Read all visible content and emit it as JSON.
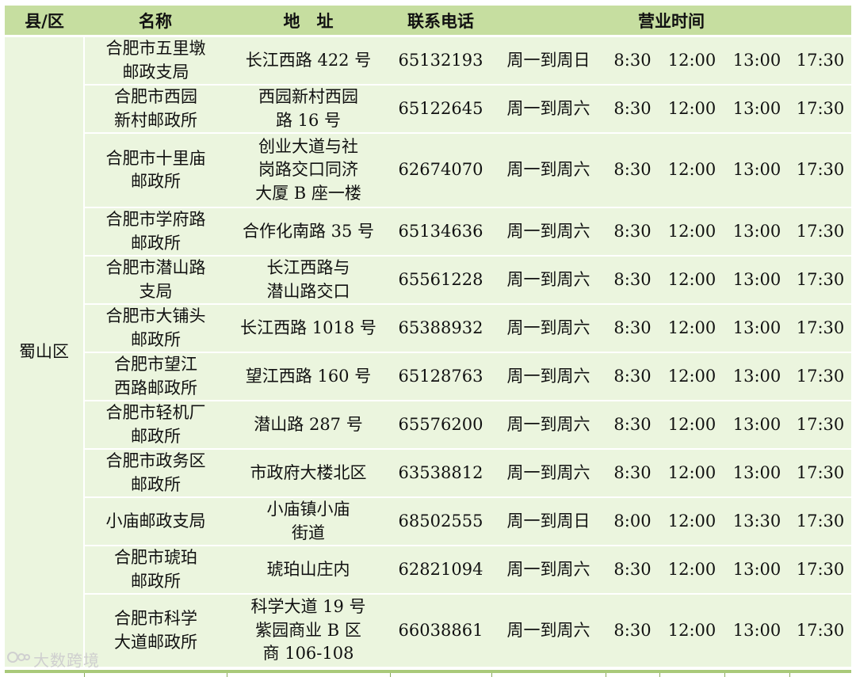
{
  "headers": {
    "county": "县/区",
    "name": "名称",
    "address": "地　址",
    "phone": "联系电话",
    "hours": "营业时间"
  },
  "county": "蜀山区",
  "rows": [
    {
      "name": "合肥市五里墩\n邮政支局",
      "address": "长江西路 422 号",
      "phone": "65132193",
      "days": "周一到周日",
      "t1": "8:30",
      "t2": "12:00",
      "t3": "13:00",
      "t4": "17:30"
    },
    {
      "name": "合肥市西园\n新村邮政所",
      "address": "西园新村西园\n路 16 号",
      "phone": "65122645",
      "days": "周一到周六",
      "t1": "8:30",
      "t2": "12:00",
      "t3": "13:00",
      "t4": "17:30"
    },
    {
      "name": "合肥市十里庙\n邮政所",
      "address": "创业大道与社\n岗路交口同济\n大厦 B 座一楼",
      "phone": "62674070",
      "days": "周一到周六",
      "t1": "8:30",
      "t2": "12:00",
      "t3": "13:00",
      "t4": "17:30"
    },
    {
      "name": "合肥市学府路\n邮政所",
      "address": "合作化南路 35 号",
      "phone": "65134636",
      "days": "周一到周六",
      "t1": "8:30",
      "t2": "12:00",
      "t3": "13:00",
      "t4": "17:30"
    },
    {
      "name": "合肥市潜山路\n支局",
      "address": "长江西路与\n潜山路交口",
      "phone": "65561228",
      "days": "周一到周六",
      "t1": "8:30",
      "t2": "12:00",
      "t3": "13:00",
      "t4": "17:30"
    },
    {
      "name": "合肥市大铺头\n邮政所",
      "address": "长江西路 1018 号",
      "phone": "65388932",
      "days": "周一到周六",
      "t1": "8:30",
      "t2": "12:00",
      "t3": "13:00",
      "t4": "17:30"
    },
    {
      "name": "合肥市望江\n西路邮政所",
      "address": "望江西路 160 号",
      "phone": "65128763",
      "days": "周一到周六",
      "t1": "8:30",
      "t2": "12:00",
      "t3": "13:00",
      "t4": "17:30"
    },
    {
      "name": "合肥市轻机厂\n邮政所",
      "address": "潜山路 287 号",
      "phone": "65576200",
      "days": "周一到周六",
      "t1": "8:30",
      "t2": "12:00",
      "t3": "13:00",
      "t4": "17:30"
    },
    {
      "name": "合肥市政务区\n邮政所",
      "address": "市政府大楼北区",
      "phone": "63538812",
      "days": "周一到周六",
      "t1": "8:30",
      "t2": "12:00",
      "t3": "13:00",
      "t4": "17:30"
    },
    {
      "name": "小庙邮政支局",
      "address": "小庙镇小庙\n街道",
      "phone": "68502555",
      "days": "周一到周日",
      "t1": "8:00",
      "t2": "12:00",
      "t3": "13:30",
      "t4": "17:30"
    },
    {
      "name": "合肥市琥珀\n邮政所",
      "address": "琥珀山庄内",
      "phone": "62821094",
      "days": "周一到周六",
      "t1": "8:30",
      "t2": "12:00",
      "t3": "13:00",
      "t4": "17:30"
    },
    {
      "name": "合肥市科学\n大道邮政所",
      "address": "科学大道 19 号\n紫园商业 B 区\n商 106-108",
      "phone": "66038861",
      "days": "周一到周六",
      "t1": "8:30",
      "t2": "12:00",
      "t3": "13:00",
      "t4": "17:30"
    }
  ],
  "watermark": "大数跨境",
  "colors": {
    "header_bg": "#c6dea0",
    "band_bg": "#ebf5de",
    "rule": "#a9c97a"
  }
}
